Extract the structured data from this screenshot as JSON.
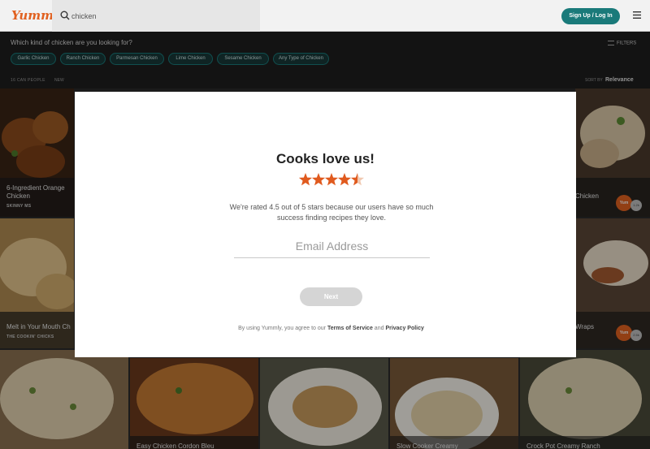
{
  "header": {
    "logo": "Yummly",
    "search_value": "chicken",
    "signup_label": "Sign Up / Log In",
    "menu_icon": "hamburger-menu-icon"
  },
  "filters": {
    "question": "Which kind of chicken are you looking for?",
    "filters_label": "FILTERS",
    "chips": [
      "Garlic Chicken",
      "Ranch Chicken",
      "Parmesan Chicken",
      "Lime Chicken",
      "Sesame Chicken",
      "Any Type of Chicken"
    ]
  },
  "sort": {
    "left_label": "16 CAN PEOPLE",
    "new_label": "NEW",
    "sort_by_label": "SORT BY",
    "sort_value": "Relevance"
  },
  "recipes": [
    {
      "title": "6-Ingredient Orange Chicken",
      "source": "SKINNY MS"
    },
    {
      "title": "Chicken",
      "badge": "Yum",
      "count": "1.2k"
    },
    {
      "title": "Melt in Your Mouth Ch",
      "source": "THE COOKIN' CHICKS"
    },
    {
      "title": "Wraps",
      "badge": "Yum",
      "count": "2.5k"
    },
    {
      "title": "Easy Chicken Cordon Bleu"
    },
    {
      "title": "Slow Cooker Creamy"
    },
    {
      "title": "Crock Pot Creamy Ranch"
    }
  ],
  "modal": {
    "title": "Cooks love us!",
    "rating": 4.5,
    "rating_max": 5,
    "description": "We're rated 4.5 out of 5 stars because our users have so much success finding recipes they love.",
    "email_placeholder": "Email Address",
    "next_label": "Next",
    "terms_prefix": "By using Yummly, you agree to our",
    "terms_link": "Terms of Service",
    "terms_and": "and",
    "privacy_link": "Privacy Policy"
  },
  "colors": {
    "brand": "#e16120",
    "accent": "#1a7a7a",
    "star": "#e05a1e"
  }
}
